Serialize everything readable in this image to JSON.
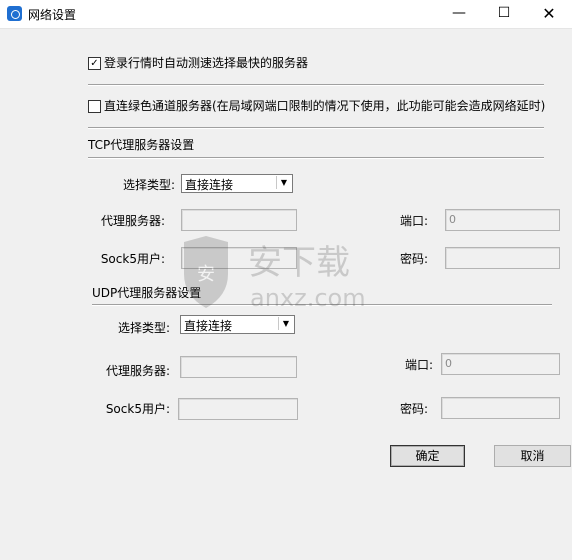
{
  "window": {
    "title": "网络设置",
    "controls": {
      "minimize": "—",
      "maximize": "☐",
      "close": "✕"
    }
  },
  "options": {
    "auto_fastest": {
      "label": "登录行情时自动测速选择最快的服务器",
      "checked": true
    },
    "direct_green": {
      "label": "直连绿色通道服务器(在局域网端口限制的情况下使用，此功能可能会造成网络延时)",
      "checked": false
    }
  },
  "tcp": {
    "section_title": "TCP代理服务器设置",
    "type_label": "选择类型:",
    "type_value": "直接连接",
    "server_label": "代理服务器:",
    "server_value": "",
    "port_label": "端口:",
    "port_value": "0",
    "user_label": "Sock5用户:",
    "user_value": "",
    "password_label": "密码:",
    "password_value": ""
  },
  "udp": {
    "section_title": "UDP代理服务器设置",
    "type_label": "选择类型:",
    "type_value": "直接连接",
    "server_label": "代理服务器:",
    "server_value": "",
    "port_label": "端口:",
    "port_value": "0",
    "user_label": "Sock5用户:",
    "user_value": "",
    "password_label": "密码:",
    "password_value": ""
  },
  "buttons": {
    "ok": "确定",
    "cancel": "取消"
  },
  "watermark": {
    "text": "安下载",
    "domain": "anxz.com",
    "badge": "安"
  },
  "colors": {
    "app_icon": "#1f6fd1",
    "background": "#f0f0f0"
  }
}
